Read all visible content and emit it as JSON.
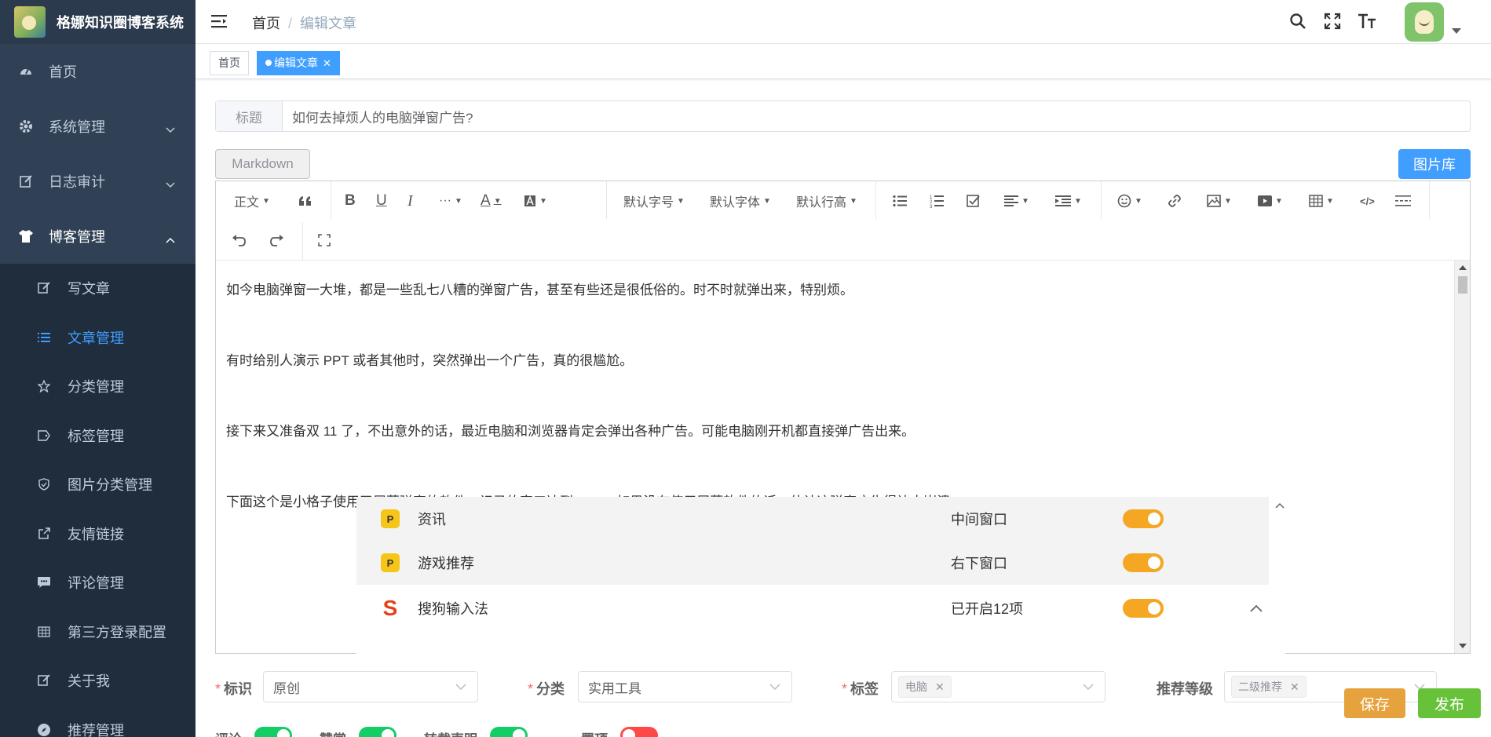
{
  "app": {
    "title": "格娜知识圈博客系统"
  },
  "sidebar": {
    "items": [
      {
        "label": "首页",
        "icon": "dashboard-icon"
      },
      {
        "label": "系统管理",
        "icon": "gear-icon"
      },
      {
        "label": "日志审计",
        "icon": "edit-icon"
      },
      {
        "label": "博客管理",
        "icon": "shirt-icon"
      }
    ],
    "blog_sub": [
      {
        "label": "写文章",
        "icon": "edit-icon"
      },
      {
        "label": "文章管理",
        "icon": "list-icon"
      },
      {
        "label": "分类管理",
        "icon": "star-icon"
      },
      {
        "label": "标签管理",
        "icon": "tag-icon"
      },
      {
        "label": "图片分类管理",
        "icon": "shield-icon"
      },
      {
        "label": "友情链接",
        "icon": "external-link-icon"
      },
      {
        "label": "评论管理",
        "icon": "comment-icon"
      },
      {
        "label": "第三方登录配置",
        "icon": "grid-icon"
      },
      {
        "label": "关于我",
        "icon": "edit-icon"
      },
      {
        "label": "推荐管理",
        "icon": "compass-icon"
      }
    ]
  },
  "navbar": {
    "breadcrumb": [
      "首页",
      "编辑文章"
    ],
    "breadcrumb_sep": "/"
  },
  "tags": [
    {
      "label": "首页"
    },
    {
      "label": "编辑文章"
    }
  ],
  "form": {
    "title_label": "标题",
    "title_value": "如何去掉烦人的电脑弹窗广告?",
    "markdown_label": "Markdown",
    "gallery_label": "图片库"
  },
  "toolbar": {
    "paragraph": "正文",
    "font_size": "默认字号",
    "font_family": "默认字体",
    "line_height": "默认行高",
    "more": "···"
  },
  "content": {
    "paragraphs": [
      "如今电脑弹窗一大堆，都是一些乱七八糟的弹窗广告，甚至有些还是很低俗的。时不时就弹出来，特别烦。",
      "有时给别人演示 PPT 或者其他时，突然弹出一个广告，真的很尴尬。",
      "接下来又准备双 11 了，不出意外的话，最近电脑和浏览器肯定会弹出各种广告。可能电脑刚开机都直接弹广告出来。",
      "下面这个是小格子使用了屏蔽弹窗的软件，记录的窗口达到999+，如果没有使用屏蔽软件的话，估计这弹窗广告得让人崩溃。"
    ],
    "image_rows": [
      {
        "name": "资讯",
        "mode": "中间窗口",
        "icon_text": "P"
      },
      {
        "name": "游戏推荐",
        "mode": "右下窗口",
        "icon_text": "P"
      },
      {
        "name": "搜狗输入法",
        "mode": "已开启12项",
        "icon_text": "S"
      }
    ]
  },
  "bottom": {
    "identity_label": "标识",
    "identity_value": "原创",
    "category_label": "分类",
    "category_value": "实用工具",
    "tag_label": "标签",
    "tag_value": "电脑",
    "recommend_label": "推荐等级",
    "recommend_value": "二级推荐",
    "save_label": "保存",
    "publish_label": "发布",
    "switches": [
      {
        "label": "评论",
        "on": true
      },
      {
        "label": "赞赏",
        "on": true
      },
      {
        "label": "转载声明",
        "on": true
      },
      {
        "label": "置顶",
        "on": false
      }
    ]
  },
  "colors": {
    "sidebar_bg": "#304156",
    "active": "#409eff",
    "save": "#e6a23c",
    "publish": "#67c23a",
    "toggle": "#f5a623"
  }
}
